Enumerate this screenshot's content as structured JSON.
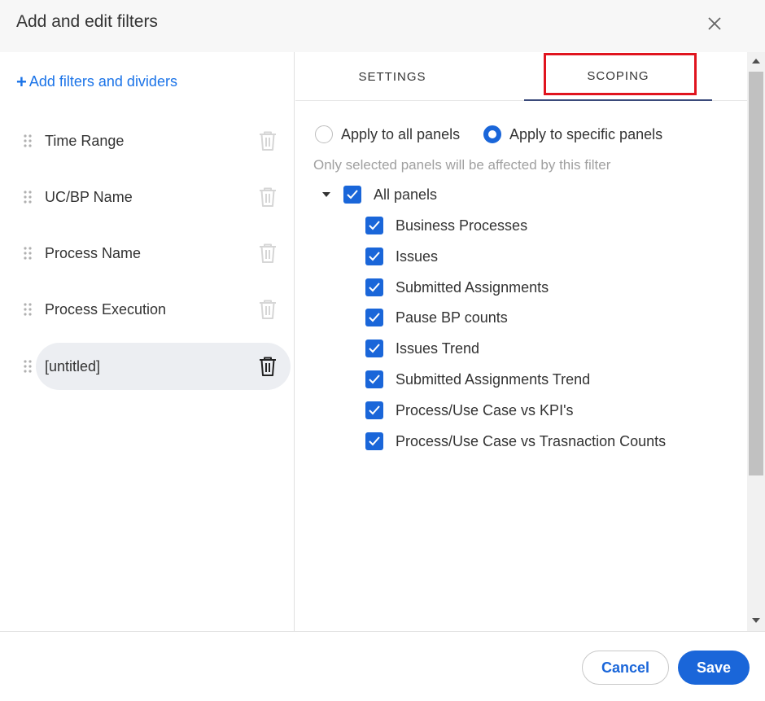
{
  "dialog": {
    "title": "Add and edit filters"
  },
  "sidebar": {
    "add_link": "Add filters and dividers",
    "filters": [
      {
        "label": "Time Range",
        "selected": false
      },
      {
        "label": "UC/BP Name",
        "selected": false
      },
      {
        "label": "Process Name",
        "selected": false
      },
      {
        "label": "Process Execution",
        "selected": false
      },
      {
        "label": "[untitled]",
        "selected": true
      }
    ]
  },
  "tabs": [
    {
      "label": "SETTINGS",
      "active": false
    },
    {
      "label": "SCOPING",
      "active": true
    }
  ],
  "scoping": {
    "radio_all": {
      "label": "Apply to all panels",
      "checked": false
    },
    "radio_specific": {
      "label": "Apply to specific panels",
      "checked": true
    },
    "hint": "Only selected panels will be affected by this filter",
    "all_panels": {
      "label": "All panels",
      "checked": true,
      "expanded": true
    },
    "panels": [
      {
        "label": "Business Processes",
        "checked": true
      },
      {
        "label": "Issues",
        "checked": true
      },
      {
        "label": "Submitted Assignments",
        "checked": true
      },
      {
        "label": "Pause BP counts",
        "checked": true
      },
      {
        "label": "Issues Trend",
        "checked": true
      },
      {
        "label": "Submitted Assignments Trend",
        "checked": true
      },
      {
        "label": "Process/Use Case vs KPI's",
        "checked": true
      },
      {
        "label": "Process/Use Case vs Trasnaction Counts",
        "checked": true
      }
    ]
  },
  "footer": {
    "cancel_label": "Cancel",
    "save_label": "Save"
  },
  "colors": {
    "accent": "#1a66d9",
    "highlight": "#e0141e",
    "link": "#1a73e8"
  },
  "icons": {
    "close": "close-icon",
    "grip": "drag-handle-icon",
    "trash": "trash-icon",
    "plus": "plus-icon",
    "check": "check-icon",
    "caret": "caret-down-icon"
  }
}
